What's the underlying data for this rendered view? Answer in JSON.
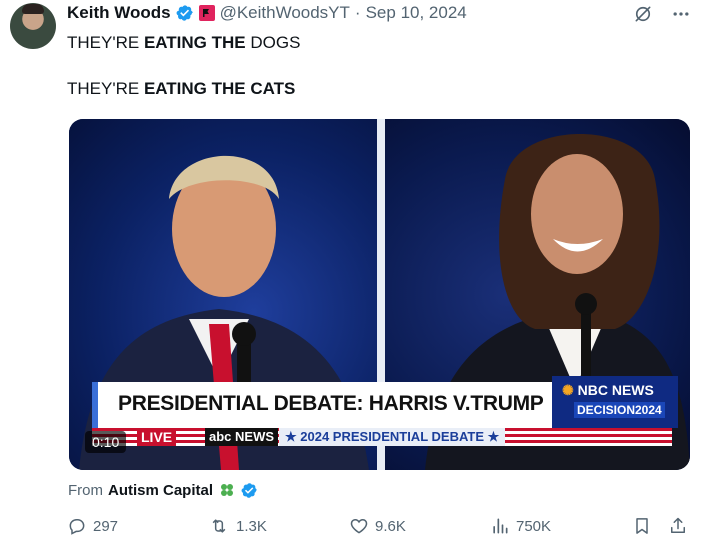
{
  "author": {
    "display_name": "Keith Woods",
    "handle": "@KeithWoodsYT",
    "separator": "·",
    "date": "Sep 10, 2024"
  },
  "tweet": {
    "line1": {
      "a": "THEY'RE ",
      "b": "EATING THE",
      "c": " DOGS"
    },
    "line2": {
      "a": "THEY'RE ",
      "b": "EATING THE CATS"
    }
  },
  "video": {
    "headline": "PRESIDENTIAL DEBATE: HARRIS V.TRUMP",
    "network": "NBC NEWS",
    "decision": "DECISION2024",
    "live": "LIVE",
    "abc": "abc NEWS",
    "ticker_text": "★ 2024 PRESIDENTIAL DEBATE ★",
    "timer": "0:10"
  },
  "source": {
    "prefix": "From",
    "name": "Autism Capital"
  },
  "actions": {
    "replies": "297",
    "reposts": "1.3K",
    "likes": "9.6K",
    "views": "750K"
  },
  "colors": {
    "verified": "#1d9bf0",
    "text": "#0f1419",
    "muted": "#536471"
  }
}
